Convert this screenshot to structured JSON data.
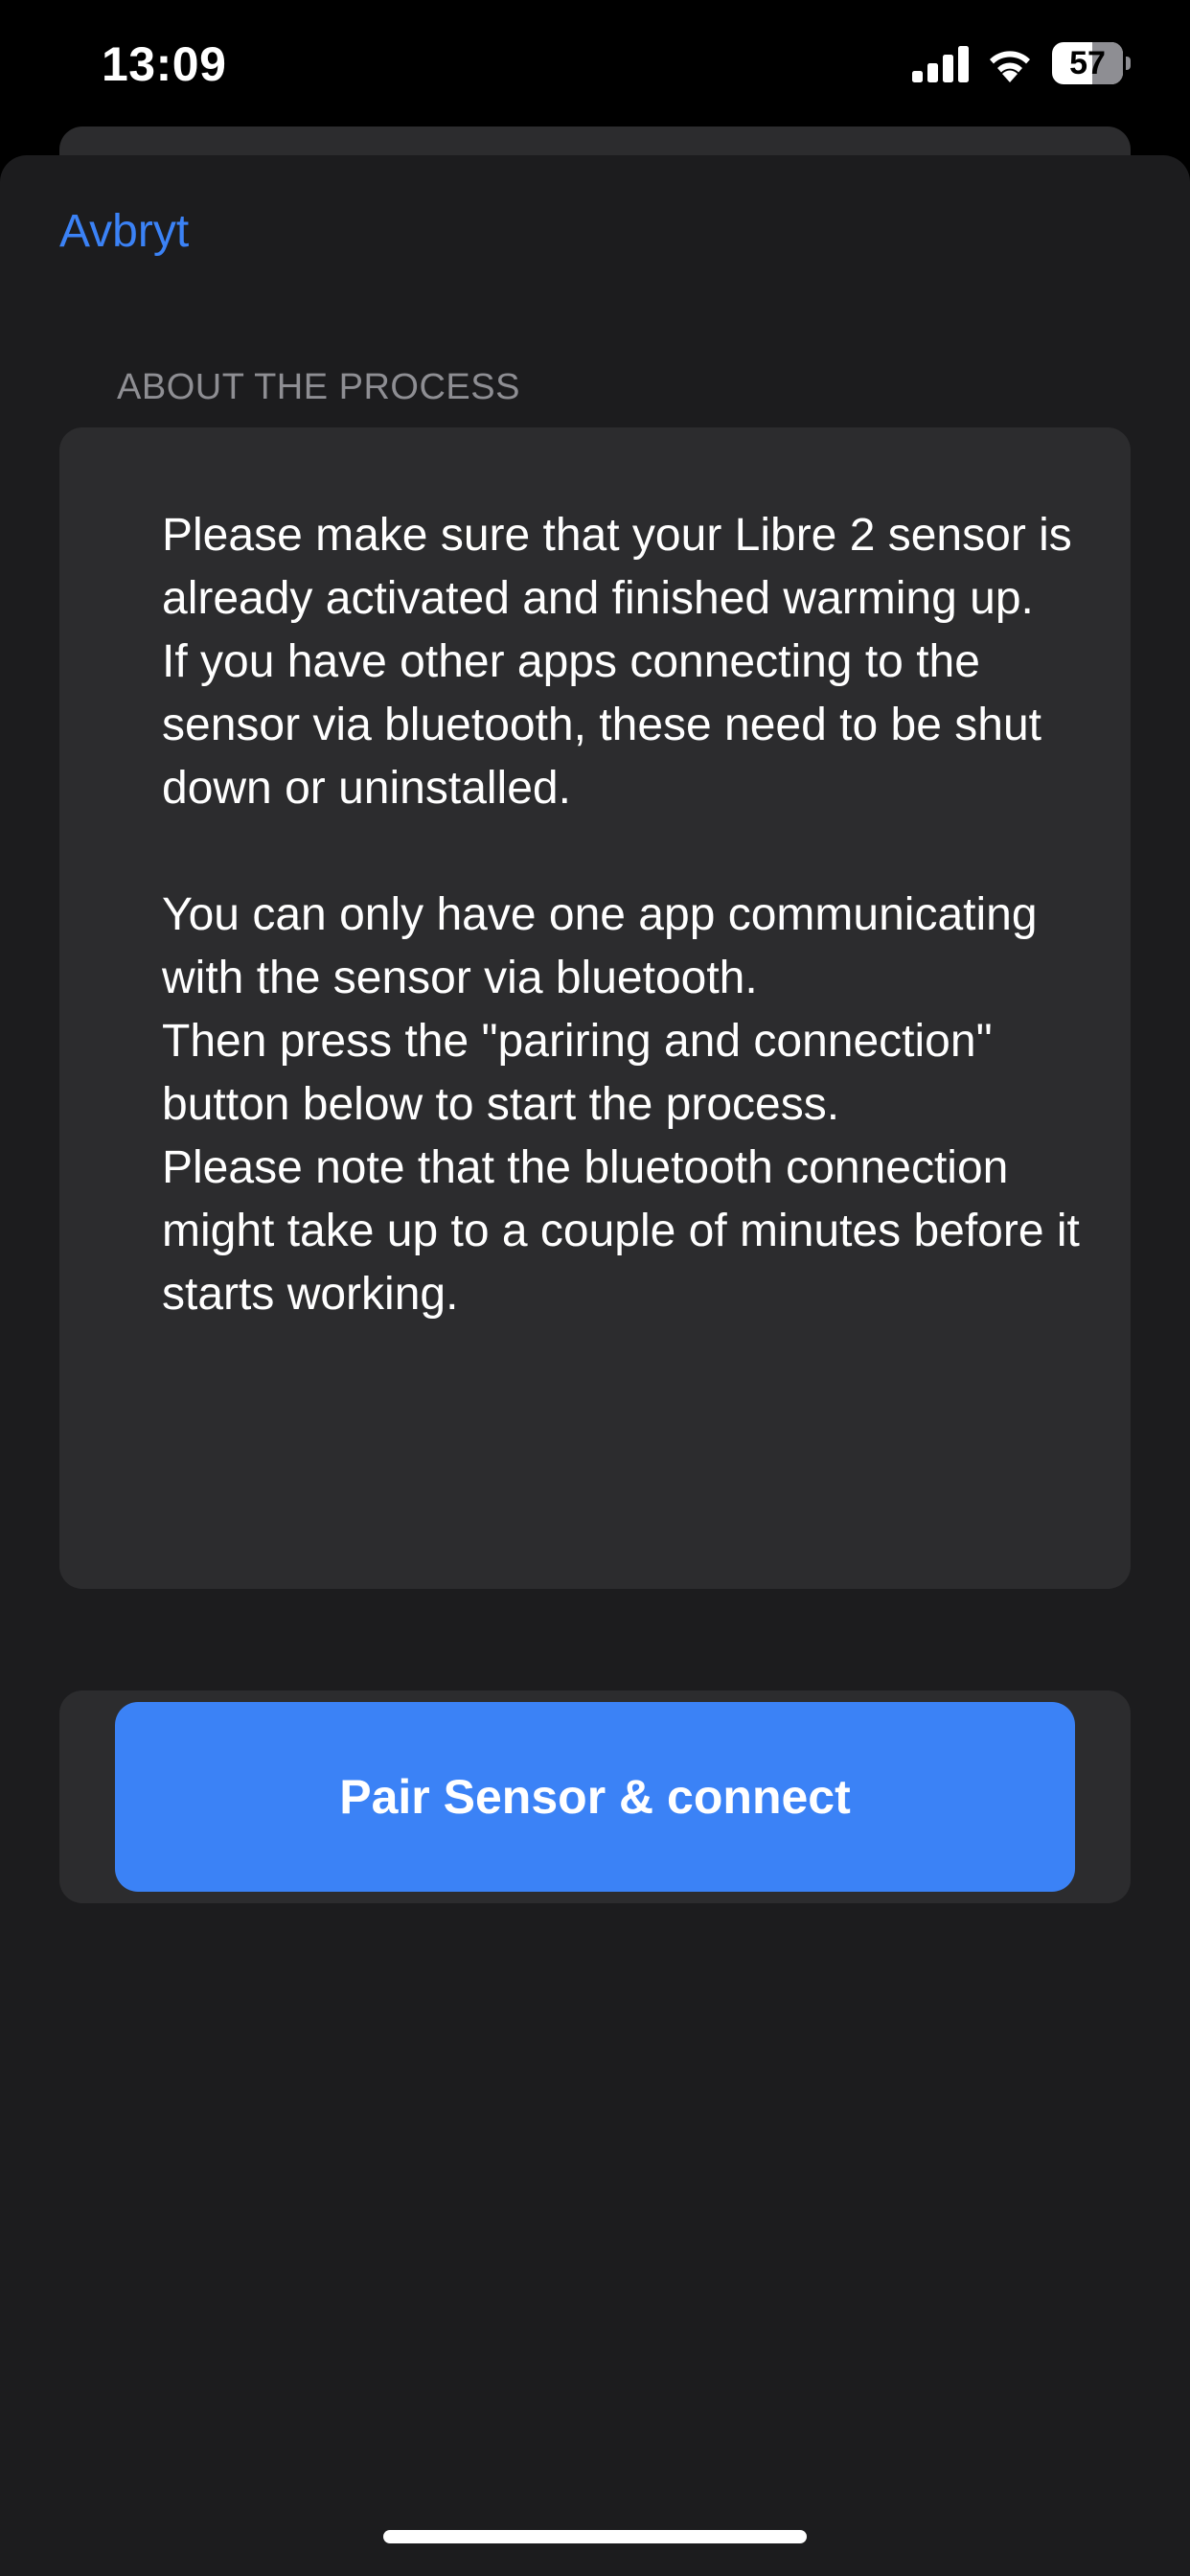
{
  "status_bar": {
    "time": "13:09",
    "signal_icon": "cellular-signal-icon",
    "wifi_icon": "wifi-icon",
    "battery_icon": "battery-icon",
    "battery_level": "57"
  },
  "nav": {
    "cancel_label": "Avbryt"
  },
  "about_section": {
    "header": "ABOUT THE PROCESS",
    "body": "Please make sure that your Libre 2 sensor is already activated and finished warming up.\nIf you have other apps connecting to the sensor via bluetooth, these need to be shut down or uninstalled.\n\nYou can only have one app communicating with the sensor via bluetooth.\nThen press the \"pariring and connection\" button below to start the process.\nPlease note that the bluetooth connection might take up to a couple of minutes before it starts working."
  },
  "actions": {
    "pair_button_label": "Pair Sensor & connect"
  },
  "colors": {
    "accent": "#3b82f6",
    "sheet_background": "#1c1c1e",
    "card_background": "#2c2c2e",
    "secondary_text": "#8e8e93"
  }
}
